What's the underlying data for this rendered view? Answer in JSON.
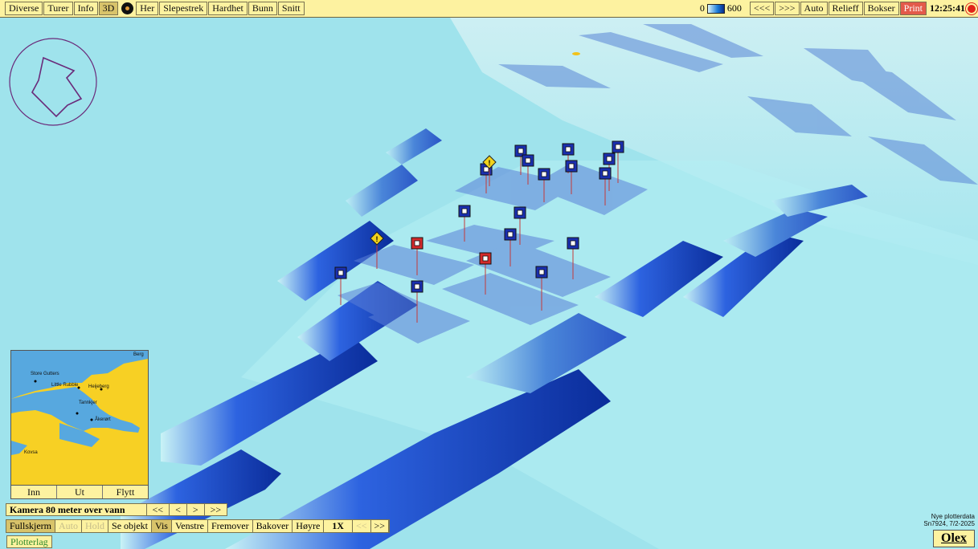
{
  "toolbar": {
    "left": [
      "Diverse",
      "Turer",
      "Info",
      "3D",
      "Her",
      "Slepestrek",
      "Hardhet",
      "Bunn",
      "Snitt"
    ],
    "active": "3D",
    "depth_min": "0",
    "depth_max": "600",
    "right": [
      "<<<",
      ">>>",
      "Auto",
      "Relieff",
      "Bokser",
      "Print"
    ],
    "clock": "12:25:41"
  },
  "minimap": {
    "labels": [
      "Store Gutters",
      "Little Rubble",
      "Heijeberg",
      "Tannkjer",
      "Åkerørt",
      "Kovsa",
      "Berg"
    ],
    "buttons": [
      "Inn",
      "Ut",
      "Flytt"
    ]
  },
  "camera": {
    "label": "Kamera 80 meter over vann",
    "buttons": [
      "<<",
      "<",
      ">",
      ">>"
    ]
  },
  "bottombar": {
    "buttons": [
      "Fullskjerm",
      "Auto",
      "Hold",
      "Se objekt",
      "Vis",
      "Venstre",
      "Fremover",
      "Bakover",
      "Høyre",
      "1X",
      "<<",
      ">>"
    ]
  },
  "plotterlag": "Plotterlag",
  "plotinfo": {
    "line1": "Nye plotterdata",
    "line2": "Sn7924, 7/2-2025"
  },
  "brand": "Olex",
  "colors": {
    "toolbar_bg": "#fdf2a0",
    "sea_light": "#9fe3ec",
    "sea_deep": "#0a2c8a",
    "marker_blue": "#1a2fb0",
    "marker_red": "#d42a2a",
    "warning_yellow": "#f2d21a",
    "print_red": "#e35a4a"
  },
  "markers": {
    "blue_count": 16,
    "red_count": 2,
    "warning_count": 2
  }
}
